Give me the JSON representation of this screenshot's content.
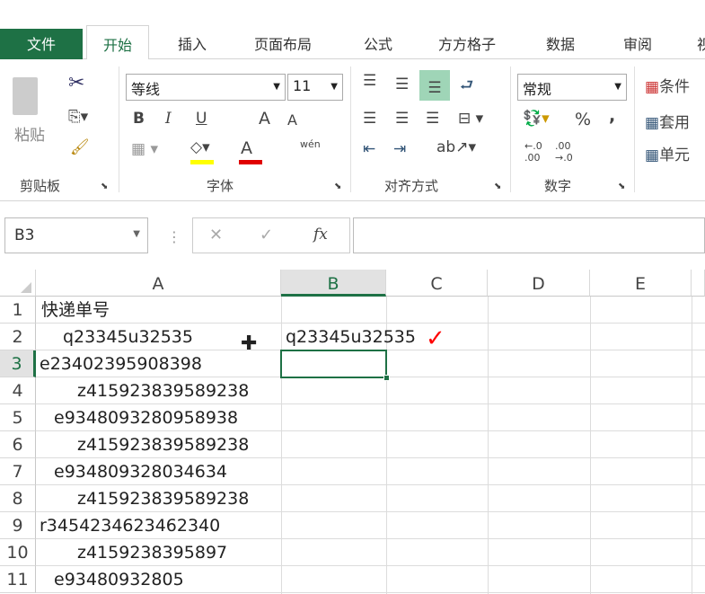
{
  "ribbon_tabs": {
    "file": "文件",
    "items": [
      "开始",
      "插入",
      "页面布局",
      "公式",
      "方方格子",
      "数据",
      "审阅",
      "视"
    ]
  },
  "clipboard": {
    "paste": "粘贴",
    "label": "剪贴板"
  },
  "font": {
    "name": "等线",
    "size": "11",
    "label": "字体",
    "bold": "B",
    "italic": "I",
    "underline": "U",
    "grow": "A",
    "shrink": "A",
    "phonetic": "wén",
    "fill_color": "#ffff00",
    "font_color": "#e00000"
  },
  "alignment": {
    "label": "对齐方式"
  },
  "number": {
    "format": "常规",
    "label": "数字",
    "percent": "%",
    "comma": ","
  },
  "styles": {
    "conditional": "条件",
    "table": "套用",
    "cell": "单元"
  },
  "formula_bar": {
    "name_box": "B3",
    "fx": "fx",
    "value": ""
  },
  "columns": [
    "A",
    "B",
    "C",
    "D",
    "E"
  ],
  "rows": [
    {
      "n": "1",
      "a": "快递单号",
      "b": ""
    },
    {
      "n": "2",
      "a": "q23345u32535",
      "b": "q23345u32535"
    },
    {
      "n": "3",
      "a": "e23402395908398",
      "b": ""
    },
    {
      "n": "4",
      "a": "z415923839589238",
      "b": ""
    },
    {
      "n": "5",
      "a": "e9348093280958938",
      "b": ""
    },
    {
      "n": "6",
      "a": "z415923839589238",
      "b": ""
    },
    {
      "n": "7",
      "a": "e934809328034634",
      "b": ""
    },
    {
      "n": "8",
      "a": "z415923839589238",
      "b": ""
    },
    {
      "n": "9",
      "a": "r3454234623462340",
      "b": ""
    },
    {
      "n": "10",
      "a": "z4159238395897",
      "b": ""
    },
    {
      "n": "11",
      "a": "e93480932805",
      "b": ""
    }
  ],
  "annotation": {
    "checkmark_color": "#ff0000"
  },
  "accent": "#1e7145"
}
